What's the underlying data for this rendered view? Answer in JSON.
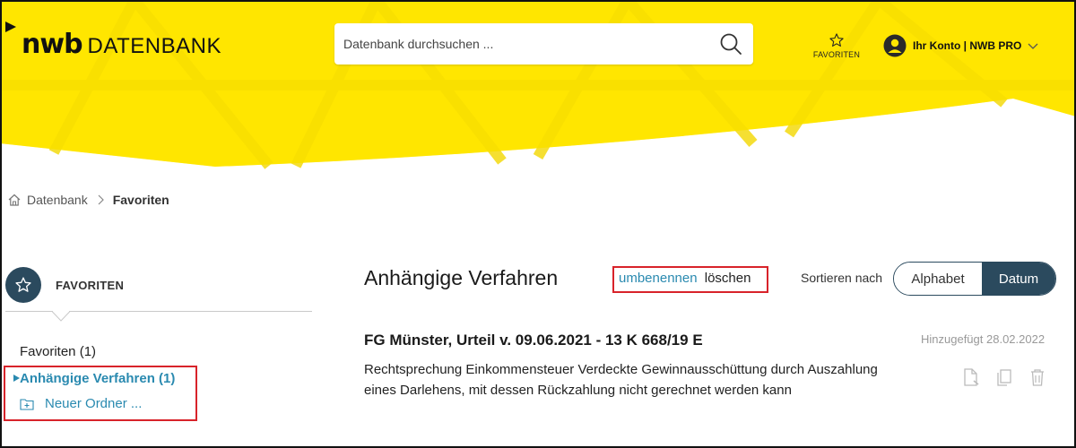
{
  "app": {
    "logo_main": "nwb",
    "logo_sub": "DATENBANK"
  },
  "header": {
    "search_placeholder": "Datenbank durchsuchen ...",
    "favorites_label": "FAVORITEN",
    "account_label": "Ihr Konto | NWB PRO",
    "brand_color": "#ffe600"
  },
  "breadcrumb": {
    "items": [
      "Datenbank",
      "Favoriten"
    ]
  },
  "sidebar": {
    "title": "FAVORITEN",
    "items": [
      {
        "label": "Favoriten (1)"
      },
      {
        "label": "Anhängige Verfahren (1)",
        "active": true
      },
      {
        "label": "Neuer Ordner ..."
      }
    ]
  },
  "main": {
    "title": "Anhängige Verfahren",
    "rename_label": "umbenennen",
    "delete_label": "löschen",
    "sort_label": "Sortieren nach",
    "sort_options": [
      "Alphabet",
      "Datum"
    ],
    "sort_selected": "Datum",
    "entries": [
      {
        "title": "FG Münster, Urteil v. 09.06.2021 - 13 K 668/19 E",
        "added": "Hinzugefügt 28.02.2022",
        "description": "Rechtsprechung Einkommensteuer Verdeckte Gewinnausschüttung durch Auszahlung eines Darlehens, mit dessen Rückzahlung nicht gerechnet werden kann",
        "icons": [
          "document-pdf-icon",
          "copy-icon",
          "trash-icon"
        ]
      }
    ]
  },
  "colors": {
    "accent": "#2a8ab0",
    "dark": "#2b4a5e",
    "highlight": "#d8232a"
  }
}
